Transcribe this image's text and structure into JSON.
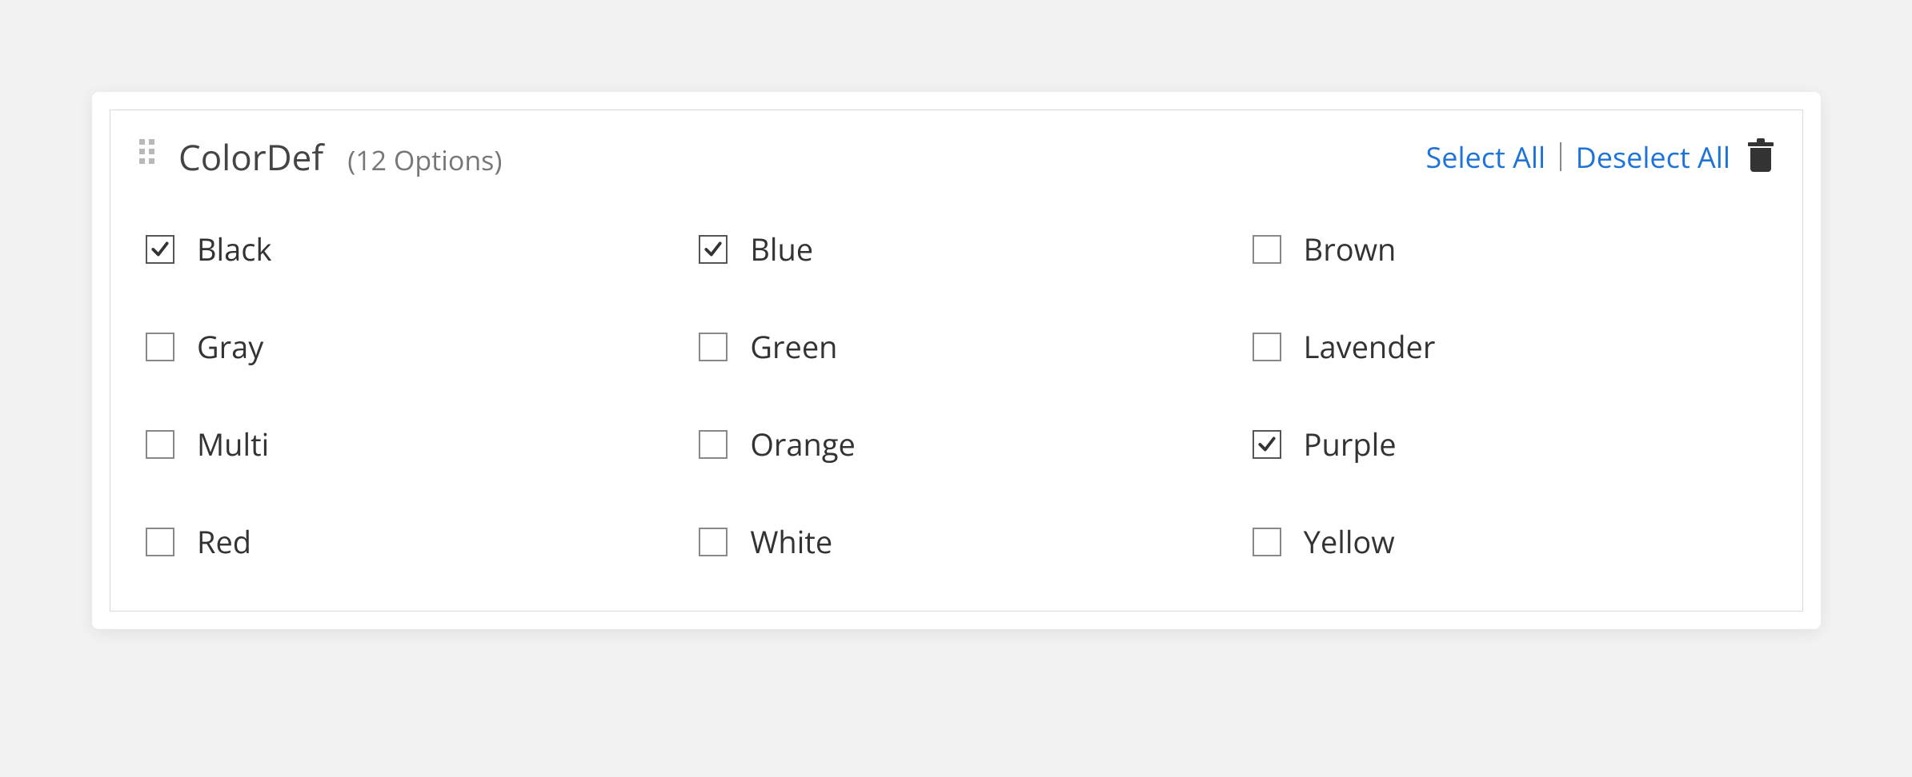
{
  "panel": {
    "title": "ColorDef",
    "count_label": "(12 Options)",
    "select_all": "Select All",
    "deselect_all": "Deselect All"
  },
  "options": [
    {
      "label": "Black",
      "checked": true
    },
    {
      "label": "Blue",
      "checked": true
    },
    {
      "label": "Brown",
      "checked": false
    },
    {
      "label": "Gray",
      "checked": false
    },
    {
      "label": "Green",
      "checked": false
    },
    {
      "label": "Lavender",
      "checked": false
    },
    {
      "label": "Multi",
      "checked": false
    },
    {
      "label": "Orange",
      "checked": false
    },
    {
      "label": "Purple",
      "checked": true
    },
    {
      "label": "Red",
      "checked": false
    },
    {
      "label": "White",
      "checked": false
    },
    {
      "label": "Yellow",
      "checked": false
    }
  ]
}
